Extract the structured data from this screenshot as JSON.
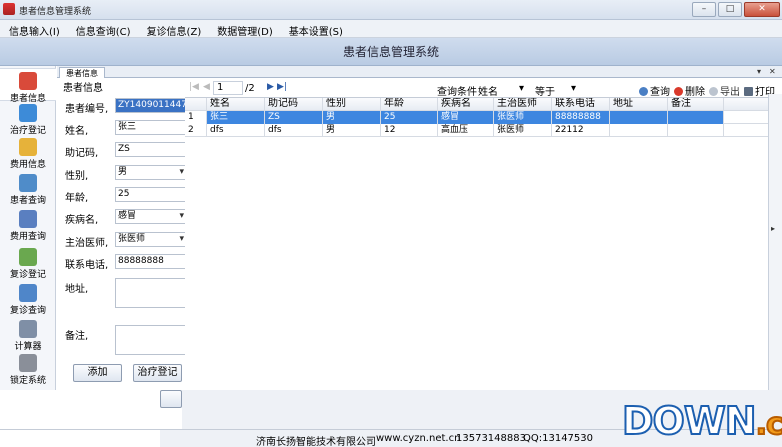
{
  "window": {
    "title": "患者信息管理系统"
  },
  "menu": [
    "信息输入(I)",
    "信息查询(C)",
    "复诊信息(Z)",
    "数据管理(D)",
    "基本设置(S)"
  ],
  "banner": "患者信息管理系统",
  "sidebar": [
    {
      "label": "患者信息",
      "icon": "patient-icon",
      "color": "#d94a3a"
    },
    {
      "label": "治疗登记",
      "icon": "treatment-icon",
      "color": "#3d8bd8"
    },
    {
      "label": "费用信息",
      "icon": "fee-icon",
      "color": "#e6b23a"
    },
    {
      "label": "患者查询",
      "icon": "patient-search-icon",
      "color": "#4f8cc9"
    },
    {
      "label": "费用查询",
      "icon": "fee-search-icon",
      "color": "#5a7fc0"
    },
    {
      "label": "复诊登记",
      "icon": "revisit-register-icon",
      "color": "#6aa84f"
    },
    {
      "label": "复诊查询",
      "icon": "revisit-search-icon",
      "color": "#4f86c9"
    },
    {
      "label": "计算器",
      "icon": "calculator-icon",
      "color": "#7f8fa6"
    },
    {
      "label": "锁定系统",
      "icon": "lock-icon",
      "color": "#8a8f99"
    }
  ],
  "tab": {
    "label": "患者信息"
  },
  "form": {
    "title": "患者信息",
    "fields": {
      "id": {
        "label": "患者编号,",
        "value": "ZY140901144720"
      },
      "name": {
        "label": "姓名,",
        "value": "张三"
      },
      "code": {
        "label": "助记码,",
        "value": "ZS"
      },
      "gender": {
        "label": "性别,",
        "value": "男"
      },
      "age": {
        "label": "年龄,",
        "value": "25"
      },
      "disease": {
        "label": "疾病名,",
        "value": "感冒"
      },
      "doctor": {
        "label": "主治医师,",
        "value": "张医师"
      },
      "phone": {
        "label": "联系电话,",
        "value": "88888888"
      },
      "address": {
        "label": "地址,",
        "value": ""
      },
      "note": {
        "label": "备注,",
        "value": ""
      }
    },
    "buttons": {
      "add": "添加",
      "treat": "治疗登记"
    }
  },
  "pager": {
    "page": "1",
    "total": "/2",
    "condition_label": "查询条件",
    "field": "姓名",
    "operator": "等于",
    "value": ""
  },
  "toolbar": {
    "query": "查询",
    "delete": "删除",
    "export": "导出",
    "print": "打印"
  },
  "table": {
    "columns": [
      "姓名",
      "助记码",
      "性别",
      "年龄",
      "疾病名",
      "主治医师",
      "联系电话",
      "地址",
      "备注"
    ],
    "rows": [
      {
        "idx": "1",
        "cells": [
          "张三",
          "ZS",
          "男",
          "25",
          "感冒",
          "张医师",
          "88888888",
          "",
          ""
        ]
      },
      {
        "idx": "2",
        "cells": [
          "dfs",
          "dfs",
          "男",
          "12",
          "高血压",
          "张医师",
          "22112",
          "",
          ""
        ]
      }
    ]
  },
  "status": {
    "company": "济南长扬智能技术有限公司",
    "site": "www.cyzn.net.cn",
    "phone": "13573148883",
    "qq": "QQ:13147530"
  },
  "watermark": {
    "text": "DOWN",
    "suffix": ".cc"
  }
}
